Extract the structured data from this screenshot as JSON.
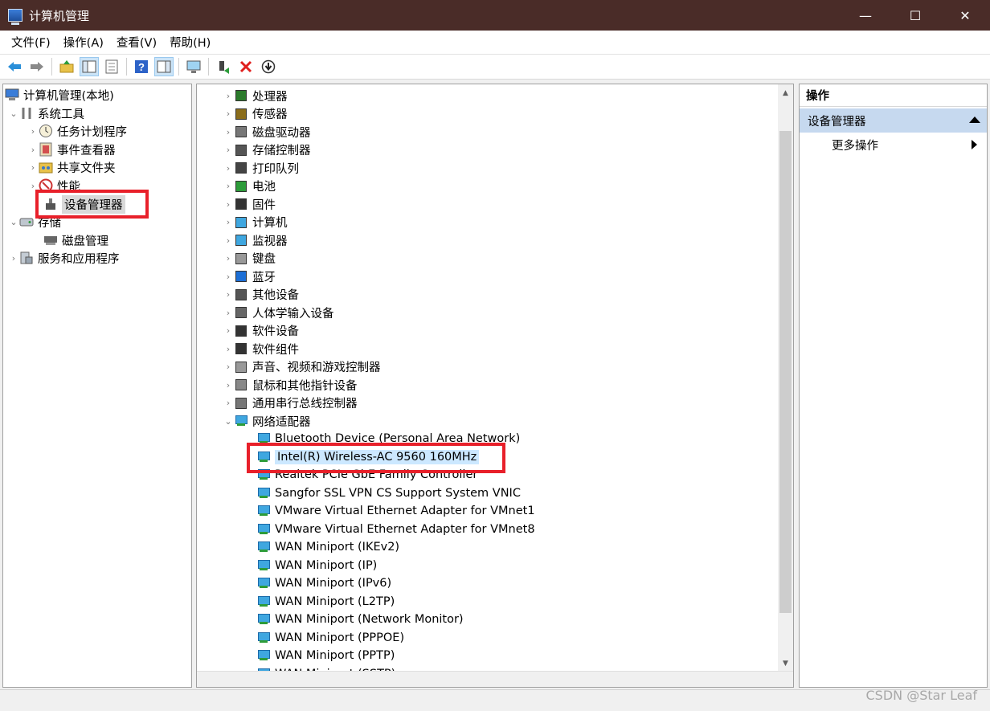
{
  "window": {
    "title": "计算机管理",
    "controls": {
      "minimize": "—",
      "maximize": "☐",
      "close": "✕"
    }
  },
  "menu": [
    "文件(F)",
    "操作(A)",
    "查看(V)",
    "帮助(H)"
  ],
  "toolbar": {
    "icons": [
      "back-arrow-icon",
      "forward-arrow-icon",
      "up-folder-icon",
      "show-tree-icon",
      "properties-icon",
      "help-icon",
      "show-action-pane-icon",
      "monitor-scan-icon",
      "enable-device-icon",
      "uninstall-icon",
      "update-driver-icon"
    ]
  },
  "left_tree": {
    "root": "计算机管理(本地)",
    "system_tools": "系统工具",
    "task_scheduler": "任务计划程序",
    "event_viewer": "事件查看器",
    "shared_folders": "共享文件夹",
    "performance": "性能",
    "device_manager": "设备管理器",
    "storage": "存储",
    "disk_management": "磁盘管理",
    "services_apps": "服务和应用程序"
  },
  "device_tree": {
    "categories": [
      "处理器",
      "传感器",
      "磁盘驱动器",
      "存储控制器",
      "打印队列",
      "电池",
      "固件",
      "计算机",
      "监视器",
      "键盘",
      "蓝牙",
      "其他设备",
      "人体学输入设备",
      "软件设备",
      "软件组件",
      "声音、视频和游戏控制器",
      "鼠标和其他指针设备",
      "通用串行总线控制器"
    ],
    "expanded_category": "网络适配器",
    "adapters": [
      "Bluetooth Device (Personal Area Network)",
      "Intel(R) Wireless-AC 9560 160MHz",
      "Realtek PCIe GbE Family Controller",
      "Sangfor SSL VPN CS Support System VNIC",
      "VMware Virtual Ethernet Adapter for VMnet1",
      "VMware Virtual Ethernet Adapter for VMnet8",
      "WAN Miniport (IKEv2)",
      "WAN Miniport (IP)",
      "WAN Miniport (IPv6)",
      "WAN Miniport (L2TP)",
      "WAN Miniport (Network Monitor)",
      "WAN Miniport (PPPOE)",
      "WAN Miniport (PPTP)",
      "WAN Miniport (SSTP)"
    ]
  },
  "actions": {
    "header": "操作",
    "section": "设备管理器",
    "more": "更多操作"
  },
  "watermark": "CSDN @Star Leaf",
  "colors": {
    "titlebar": "#4a2c28",
    "highlight_box": "#e8202a",
    "selection": "#cce8ff",
    "action_section": "#c6d9ef"
  }
}
